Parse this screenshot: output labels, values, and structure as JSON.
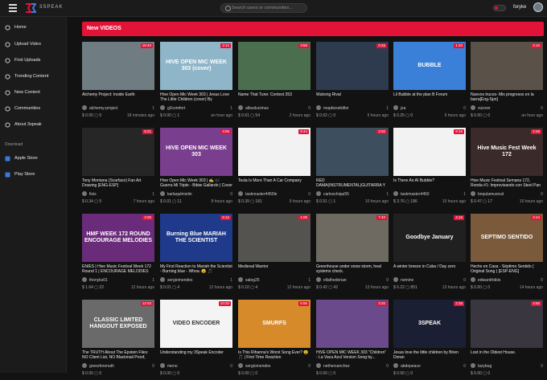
{
  "header": {
    "brand": "3SPEAK",
    "search_placeholder": "Search users or communities...",
    "username": "foryke"
  },
  "sidebar": {
    "items": [
      {
        "label": "Home",
        "icon": "home-icon"
      },
      {
        "label": "Upload Video",
        "icon": "upload-icon"
      },
      {
        "label": "First Uploads",
        "icon": "star-icon"
      },
      {
        "label": "Trending Content",
        "icon": "flame-icon"
      },
      {
        "label": "New Content",
        "icon": "clock-icon"
      },
      {
        "label": "Communities",
        "icon": "people-icon"
      },
      {
        "label": "About 3speak",
        "icon": "info-icon"
      }
    ],
    "download_heading": "Download",
    "downloads": [
      {
        "label": "Apple Store",
        "icon": "apple-store-icon"
      },
      {
        "label": "Play Store",
        "icon": "play-store-icon"
      }
    ]
  },
  "section_title": "New VIDEOS",
  "videos": [
    {
      "title": "Alchemy Project: Inside Earth",
      "author": "alchemy-project",
      "views": "1",
      "payout": "$ 0.00",
      "comments": "0",
      "age": "18 minutes ago",
      "thumb_color": "#6f7d83",
      "overlay": "",
      "duration": "18:40"
    },
    {
      "title": "Hive Open Mic Week 303 | Jesus Love The Little Children (cover) By @g2comfort",
      "author": "g2comfort",
      "views": "1",
      "payout": "$ 0.00",
      "comments": "1",
      "age": "an hour ago",
      "thumb_color": "#8fb5c8",
      "overlay": "HIVE OPEN MIC WEEK 303 (cover)",
      "duration": "3:12"
    },
    {
      "title": "Name That Tune: Contest 353",
      "author": "albuslucimus",
      "views": "0",
      "payout": "$ 0.61",
      "comments": "54",
      "age": "2 hours ago",
      "thumb_color": "#4b6e4e",
      "overlay": "",
      "duration": "3:58"
    },
    {
      "title": "Wukong Rival",
      "author": "mapbossikiller",
      "views": "1",
      "payout": "$ 0.02",
      "comments": "0",
      "age": "5 hours ago",
      "thumb_color": "#2e3a4e",
      "overlay": "",
      "duration": "0:45"
    },
    {
      "title": "Lil Bubble at the plan B Forum",
      "author": "jza",
      "views": "0",
      "payout": "$ 0.25",
      "comments": "0",
      "age": "6 hours ago",
      "thumb_color": "#3a7fd8",
      "overlay": "BUBBLE",
      "duration": "1:20"
    },
    {
      "title": "Nuevos trucos- Mis progresos en la barra[Eng-Spn]",
      "author": "zuizver",
      "views": "0",
      "payout": "$ 0.00",
      "comments": "0",
      "age": "an hour ago",
      "thumb_color": "#5a5248",
      "overlay": "",
      "duration": "2:10"
    },
    {
      "title": "Tony Montana (Scarface) Fan Art Drawing [ENG-ESP]",
      "author": "fixis",
      "views": "1",
      "payout": "$ 0.34",
      "comments": "5",
      "age": "7 hours ago",
      "thumb_color": "#262626",
      "overlay": "",
      "duration": "5:21"
    },
    {
      "title": "Hive Open Mic Week 303 | ✍ 🎶 Guerra Mi Triple - Bibiw Gallardo | Cover by...",
      "author": "karlaqulmiolin",
      "views": "0",
      "payout": "$ 0.01",
      "comments": "11",
      "age": "8 hours ago",
      "thumb_color": "#7a3e8e",
      "overlay": "HIVE OPEN MIC WEEK 303",
      "duration": "3:05"
    },
    {
      "title": "Tesla Is More Than A Car Company",
      "author": "taskmaster4450le",
      "views": "0",
      "payout": "$ 0.39",
      "comments": "181",
      "age": "9 hours ago",
      "thumb_color": "#f2f2f2",
      "overlay": "",
      "duration": "8:44"
    },
    {
      "title": "RED DAMA(INSTRUMENTAL)GUITARRA Y PIANO/SPAN-ENG.",
      "author": "carloschiqui55",
      "views": "1",
      "payout": "$ 0.51",
      "comments": "1",
      "age": "10 hours ago",
      "thumb_color": "#3d4f5e",
      "overlay": "",
      "duration": "4:02"
    },
    {
      "title": "Is There An AI Bubble?",
      "author": "taskmaster4450",
      "views": "1",
      "payout": "$ 3.76",
      "comments": "186",
      "age": "10 hours ago",
      "thumb_color": "#f2f2f2",
      "overlay": "",
      "duration": "9:15"
    },
    {
      "title": "Hive Music Festival Semana 172, Ronda #1: Improvisando con Steel Pan",
      "author": "bnqulamusical",
      "views": "0",
      "payout": "$ 0.47",
      "comments": "17",
      "age": "10 hours ago",
      "thumb_color": "#3b2a2a",
      "overlay": "Hive Music Fest Week 172",
      "duration": "2:48"
    },
    {
      "title": "EN/ES | Hive Music Festival Week 172 Round 1 | ENCOURAGE MELODIES",
      "author": "thonyks01",
      "views": "1",
      "payout": "$ 1.64",
      "comments": "22",
      "age": "12 hours ago",
      "thumb_color": "#6a2c7a",
      "overlay": "HMF WEEK 172 ROUND ENCOURAGE MELODIES",
      "duration": "3:30"
    },
    {
      "title": "My First Reaction to Mariah the Scientist - Burning blue - Whoa. 😮 🎵",
      "author": "sergiomendes",
      "views": "1",
      "payout": "$ 0.01",
      "comments": "4",
      "age": "12 hours ago",
      "thumb_color": "#1f3a8a",
      "overlay": "Burning Blue MARIAH THE SCIENTIST",
      "duration": "6:12"
    },
    {
      "title": "Medieval Warrior",
      "author": "saleg25",
      "views": "1",
      "payout": "$ 0.10",
      "comments": "4",
      "age": "12 hours ago",
      "thumb_color": "#55534f",
      "overlay": "",
      "duration": "1:05"
    },
    {
      "title": "Greenhouse under snow storm, heal systems check.",
      "author": "ellathedorian",
      "views": "0",
      "payout": "$ 0.42",
      "comments": "42",
      "age": "13 hours ago",
      "thumb_color": "#6e6a62",
      "overlay": "",
      "duration": "7:40"
    },
    {
      "title": "A winter breeze in Cuba / Day zero",
      "author": "nominx",
      "views": "0",
      "payout": "$ 6.22",
      "comments": "851",
      "age": "13 hours ago",
      "thumb_color": "#202020",
      "overlay": "Goodbye January",
      "duration": "4:16"
    },
    {
      "title": "Hecho en Casa - Séptimo Sentido ( Original Song ) [ESP-ENG]",
      "author": "edwardrbibis",
      "views": "0",
      "payout": "$ 0.00",
      "comments": "0",
      "age": "14 hours ago",
      "thumb_color": "#7a5a3a",
      "overlay": "SEPTIMO SENTIDO",
      "duration": "3:44"
    },
    {
      "title": "The TRUTH About The Epstein Files: NO Client List, NO Blackmail Proof, Just...",
      "author": "greesforenuth",
      "views": "0",
      "payout": "$ 0.00",
      "comments": "0",
      "age": "",
      "thumb_color": "#6a6a6a",
      "overlay": "CLASSIC LIMITED HANGOUT EXPOSED",
      "duration": "12:03"
    },
    {
      "title": "Understanding my 3Speak Encoder",
      "author": "meno",
      "views": "0",
      "payout": "$ 0.00",
      "comments": "0",
      "age": "",
      "thumb_color": "#f4f4f4",
      "overlay": "VIDEO ENCODER",
      "duration": "10:20"
    },
    {
      "title": "Is This Rihanna's Worst Song Ever? 😮 🎵 | First Time Reaction",
      "author": "sergiomendes",
      "views": "0",
      "payout": "$ 0.00",
      "comments": "0",
      "age": "",
      "thumb_color": "#d68a2a",
      "overlay": "SMURFS",
      "duration": "5:55"
    },
    {
      "title": "HIVE OPEN MIC WEEK 303 \"Children\" - La Vaca Azul Version Song by...",
      "author": "netherxanchez",
      "views": "0",
      "payout": "$ 0.00",
      "comments": "0",
      "age": "",
      "thumb_color": "#6a4a8a",
      "overlay": "",
      "duration": "3:20"
    },
    {
      "title": "Jesus love the little children by Brien Doran",
      "author": "abdepeace",
      "views": "0",
      "payout": "$ 0.00",
      "comments": "0",
      "age": "",
      "thumb_color": "#1b1f33",
      "overlay": "3SPEAK",
      "duration": "2:35"
    },
    {
      "title": "Lost in the Oldest House.",
      "author": "lazybug",
      "views": "0",
      "payout": "$ 0.00",
      "comments": "0",
      "age": "",
      "thumb_color": "#3a3640",
      "overlay": "",
      "duration": "4:50"
    }
  ]
}
